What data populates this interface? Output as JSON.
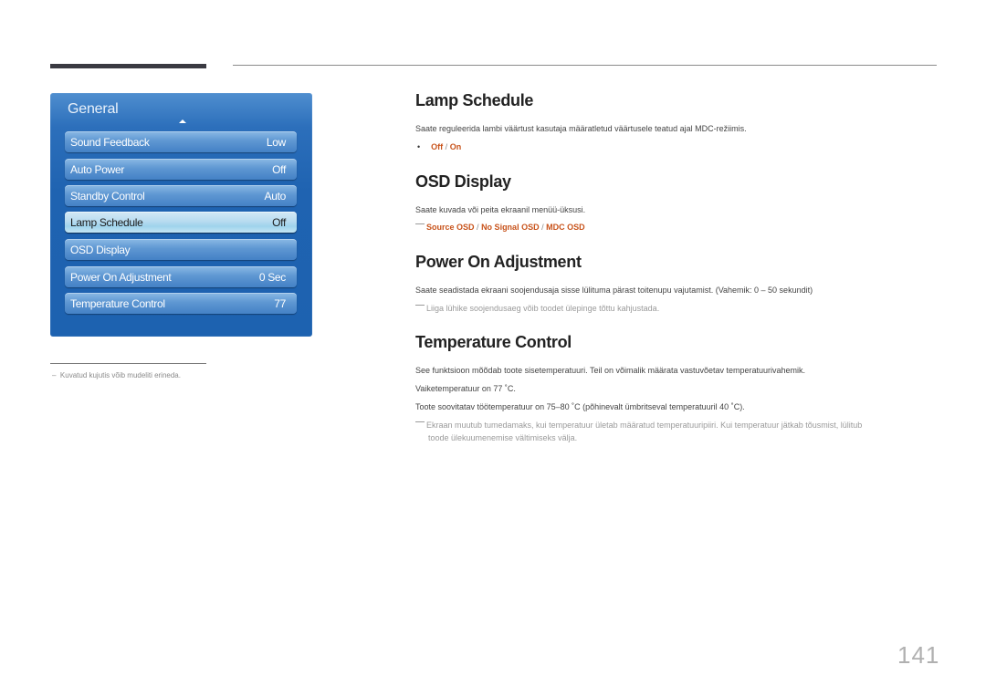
{
  "osd_menu": {
    "title": "General",
    "items": [
      {
        "label": "Sound Feedback",
        "value": "Low"
      },
      {
        "label": "Auto Power",
        "value": "Off"
      },
      {
        "label": "Standby Control",
        "value": "Auto"
      },
      {
        "label": "Lamp Schedule",
        "value": "Off",
        "selected": true
      },
      {
        "label": "OSD Display",
        "value": ""
      },
      {
        "label": "Power On Adjustment",
        "value": "0 Sec"
      },
      {
        "label": "Temperature Control",
        "value": "77"
      }
    ]
  },
  "footnote": "Kuvatud kujutis võib mudeliti erineda.",
  "sections": {
    "lamp_schedule": {
      "title": "Lamp Schedule",
      "description": "Saate reguleerida lambi väärtust kasutaja määratletud väärtusele teatud ajal MDC-režiimis.",
      "options": [
        "Off",
        "On"
      ]
    },
    "osd_display": {
      "title": "OSD Display",
      "description": "Saate kuvada või peita ekraanil menüü-üksusi.",
      "options": [
        "Source OSD",
        "No Signal OSD",
        "MDC OSD"
      ]
    },
    "power_on_adjustment": {
      "title": "Power On Adjustment",
      "description": "Saate seadistada ekraani soojendusaja sisse lülituma pärast toitenupu vajutamist. (Vahemik: 0 – 50 sekundit)",
      "note": "Liiga lühike soojendusaeg võib toodet ülepinge tõttu kahjustada."
    },
    "temperature_control": {
      "title": "Temperature Control",
      "description": "See funktsioon mõõdab toote sisetemperatuuri. Teil on võimalik määrata vastuvõetav temperatuurivahemik.",
      "default_line": "Vaiketemperatuur on 77 ˚C.",
      "recommended_line": "Toote soovitatav töötemperatuur on 75–80 ˚C (põhinevalt ümbritseval temperatuuril 40 ˚C).",
      "note_line1": "Ekraan muutub tumedamaks, kui temperatuur ületab määratud temperatuuripiiri. Kui temperatuur jätkab tõusmist, lülitub",
      "note_line2": "toode ülekuumenemise vältimiseks välja."
    }
  },
  "separator": "/",
  "page_number": "141"
}
